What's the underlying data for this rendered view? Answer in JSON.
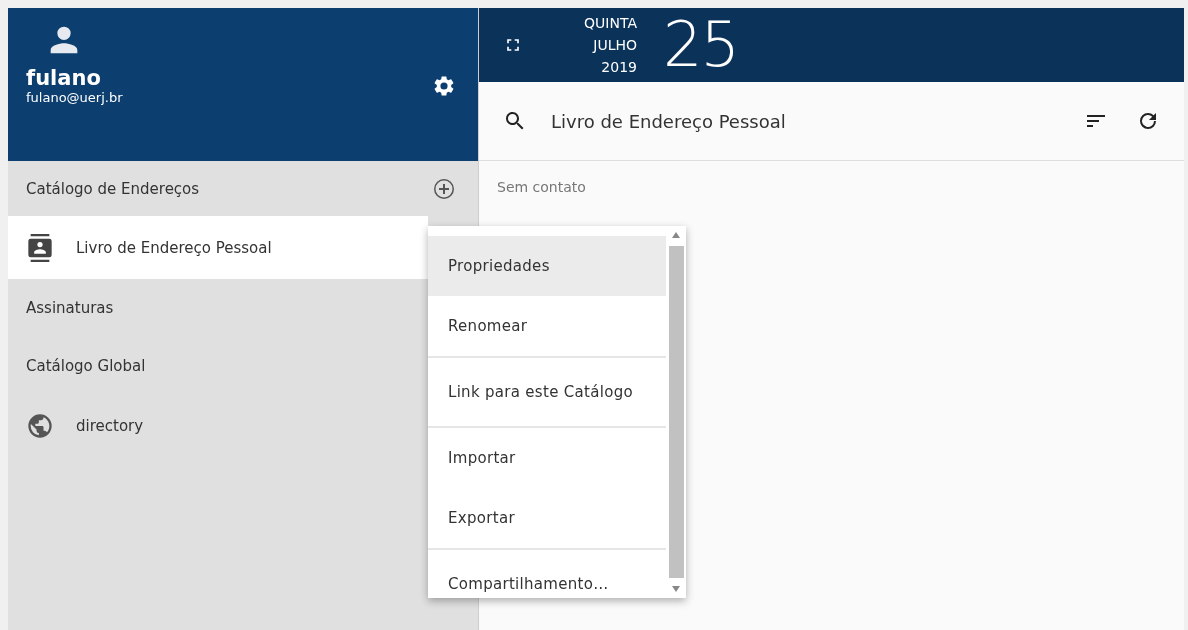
{
  "user": {
    "name": "fulano",
    "email": "fulano@uerj.br"
  },
  "date": {
    "weekday": "QUINTA",
    "month": "JULHO",
    "year": "2019",
    "day": "25"
  },
  "sidebar": {
    "items": [
      {
        "kind": "catalog_header",
        "label": "Catálogo de Endereços"
      },
      {
        "kind": "book",
        "label": "Livro de Endereço Pessoal",
        "selected": true
      },
      {
        "kind": "section",
        "label": "Assinaturas"
      },
      {
        "kind": "section",
        "label": "Catálogo Global"
      },
      {
        "kind": "globe",
        "label": "directory",
        "selected": false
      }
    ]
  },
  "toolbar": {
    "title": "Livro de Endereço Pessoal"
  },
  "contacts": {
    "empty_text": "Sem contato"
  },
  "context_menu": {
    "groups": [
      [
        {
          "label": "Propriedades",
          "selected": true
        },
        {
          "label": "Renomear",
          "selected": false
        }
      ],
      [
        {
          "label": "Link para este Catálogo",
          "selected": false
        }
      ],
      [
        {
          "label": "Importar",
          "selected": false
        },
        {
          "label": "Exportar",
          "selected": false
        }
      ],
      [
        {
          "label": "Compartilhamento…",
          "selected": false
        }
      ]
    ]
  }
}
